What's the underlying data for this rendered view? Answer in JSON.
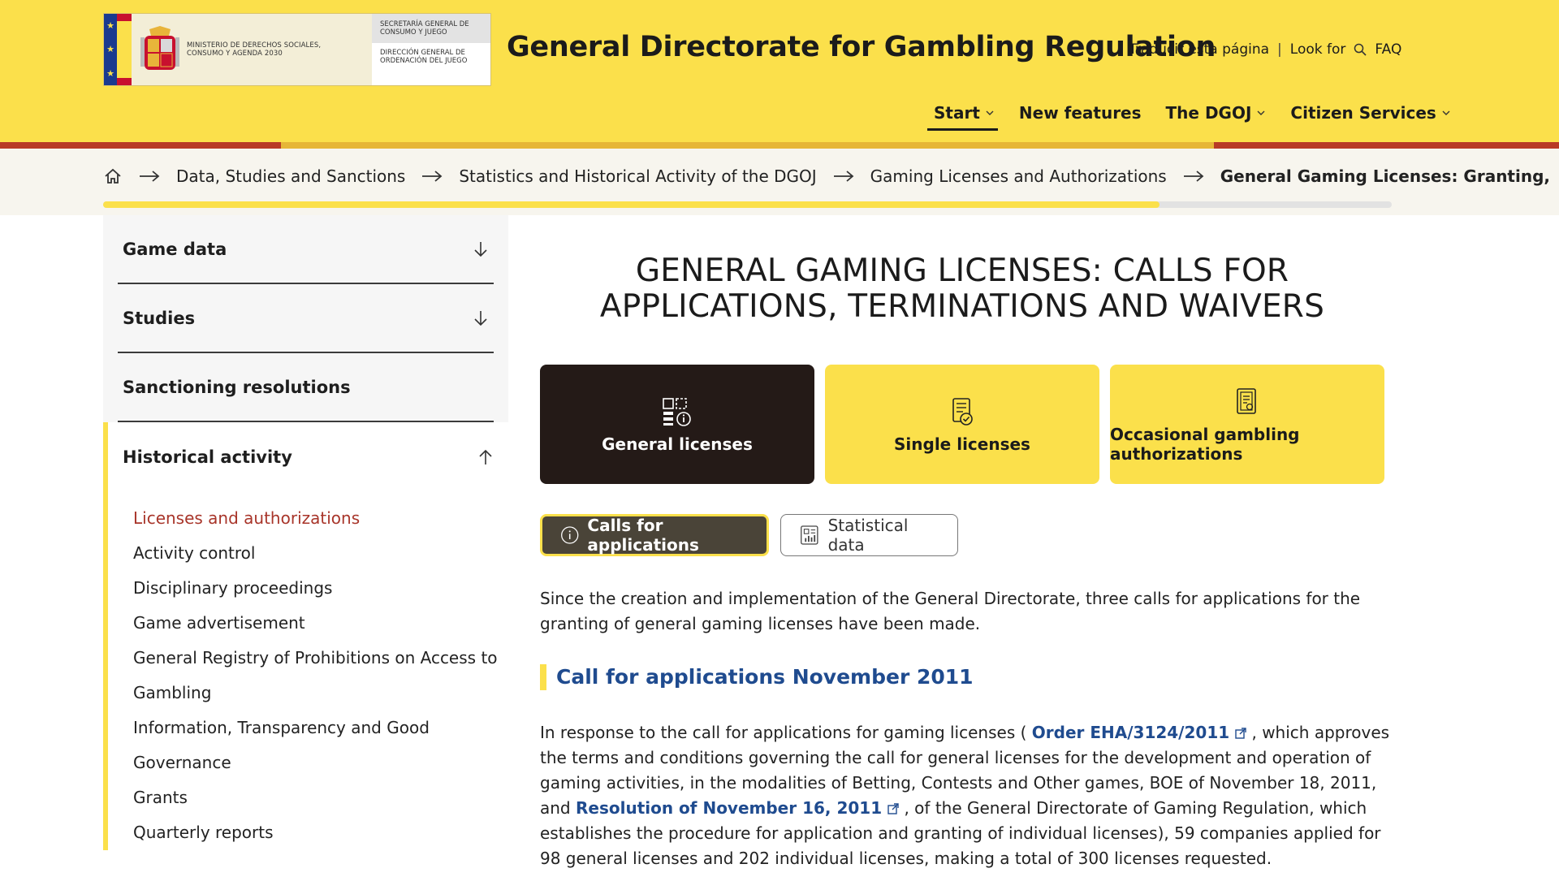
{
  "header": {
    "logo": {
      "ministry_text": "MINISTERIO DE DERECHOS SOCIALES, CONSUMO Y AGENDA 2030",
      "secretariat_text": "SECRETARÍA GENERAL DE CONSUMO Y JUEGO",
      "directorate_text": "DIRECCIÓN GENERAL DE ORDENACIÓN DEL JUEGO"
    },
    "site_title": "General Directorate for Gambling Regulation",
    "top_links": {
      "translate": "Traducir esta página",
      "separator": "|",
      "look_for": "Look for",
      "faq": "FAQ"
    },
    "nav": {
      "start": "Start",
      "new_features": "New features",
      "dgoj": "The DGOJ",
      "citizen": "Citizen Services"
    }
  },
  "breadcrumb": {
    "items": [
      "Data, Studies and Sanctions",
      "Statistics and Historical Activity of the DGOJ",
      "Gaming Licenses and Authorizations",
      "General Gaming Licenses: Granting,"
    ],
    "scroll_progress": 0.82
  },
  "sidebar": {
    "game_data": "Game data",
    "studies": "Studies",
    "sanctioning": "Sanctioning resolutions",
    "historical": "Historical activity",
    "sub_items": [
      "Licenses and authorizations",
      "Activity control",
      "Disciplinary proceedings",
      "Game advertisement",
      "General Registry of Prohibitions on Access to",
      "Gambling",
      "Information, Transparency and Good",
      "Governance",
      "Grants",
      "Quarterly reports"
    ]
  },
  "main": {
    "title_line1": "GENERAL GAMING LICENSES: CALLS FOR",
    "title_line2": "APPLICATIONS, TERMINATIONS AND WAIVERS",
    "cards": {
      "general": "General licenses",
      "single": "Single licenses",
      "occasional": "Occasional gambling authorizations"
    },
    "tabs": {
      "calls": "Calls for applications",
      "stats": "Statistical data"
    },
    "intro": "Since the creation and implementation of the General Directorate, three calls for applications for the granting of general gaming licenses have been made.",
    "section_title": "Call for applications November 2011",
    "para2": {
      "t1": "In response to the call for applications for gaming licenses ( ",
      "link1": "Order EHA/3124/2011",
      "t2": " , which approves the terms and conditions governing the call for general licenses for the development and operation of gaming activities, in the modalities of Betting, Contests and Other games, BOE of November 18, 2011, and ",
      "link2": "Resolution of November 16, 2011",
      "t3": " , of the General Directorate of Gaming Regulation, which establishes the procedure for application and granting of individual licenses), 59 companies applied for 98 general licenses and 202 individual licenses, making a total of 300 licenses requested."
    }
  },
  "colors": {
    "header_yellow": "#fbe04b",
    "dark_card": "#241a17",
    "link_blue": "#1f4b8f",
    "active_red": "#a8352a"
  }
}
